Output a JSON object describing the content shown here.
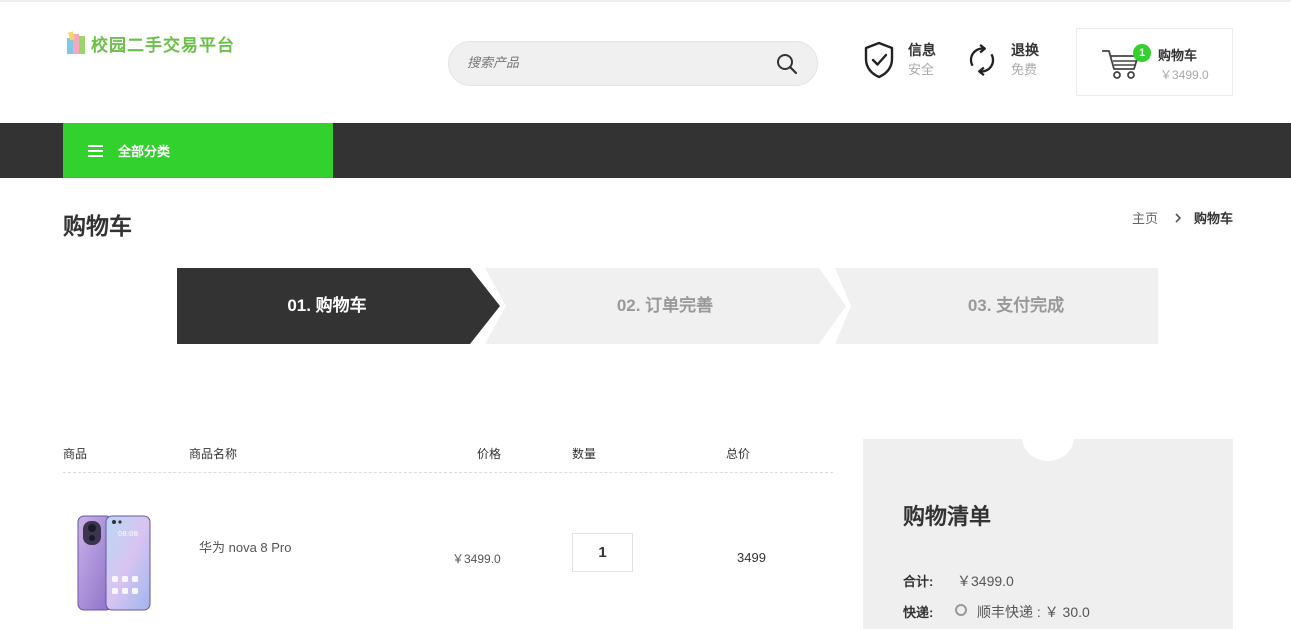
{
  "header": {
    "logo_text": "校园二手交易平台",
    "search": {
      "placeholder": "搜索产品"
    },
    "features": [
      {
        "title": "信息",
        "subtitle": "安全",
        "icon": "shield-check-icon"
      },
      {
        "title": "退换",
        "subtitle": "免费",
        "icon": "refresh-icon"
      }
    ],
    "cart": {
      "title": "购物车",
      "amount": "￥3499.0",
      "count": "1",
      "badge_color": "#32d12e"
    }
  },
  "nav": {
    "all_categories": "全部分类",
    "accent": "#32d12e",
    "bar_color": "#333333"
  },
  "page": {
    "title": "购物车",
    "breadcrumb": {
      "home": "主页",
      "current": "购物车"
    }
  },
  "steps": [
    {
      "label": "01. 购物车",
      "active": true
    },
    {
      "label": "02. 订单完善",
      "active": false
    },
    {
      "label": "03. 支付完成",
      "active": false
    }
  ],
  "cart_table": {
    "headers": {
      "product": "商品",
      "name": "商品名称",
      "price": "价格",
      "qty": "数量",
      "total": "总价"
    },
    "rows": [
      {
        "name": "华为 nova 8 Pro",
        "price": "￥3499.0",
        "qty": "1",
        "total": "3499"
      }
    ]
  },
  "summary": {
    "title": "购物清单",
    "subtotal_label": "合计:",
    "subtotal_value": "￥3499.0",
    "shipping_label": "快递:",
    "shipping_option": "顺丰快递 : ￥ 30.0"
  }
}
